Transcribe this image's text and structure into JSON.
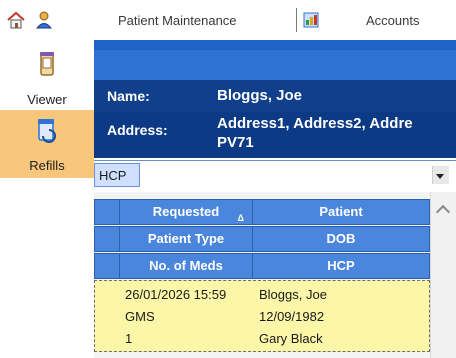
{
  "toolbar": {
    "home_icon": "home-icon",
    "user_icon": "user-icon",
    "patient_maintenance_label": "Patient Maintenance",
    "accounts_icon": "accounts-icon",
    "accounts_label": "Accounts"
  },
  "nav": {
    "items": [
      {
        "label": "Viewer",
        "icon": "viewer-icon",
        "selected": false
      },
      {
        "label": "Refills",
        "icon": "refills-icon",
        "selected": true
      }
    ]
  },
  "patient": {
    "name_label": "Name:",
    "name_value": "Bloggs, Joe",
    "address_label": "Address:",
    "address_line1": "Address1, Address2, Addre",
    "address_line2": "PV71"
  },
  "filter": {
    "selected": "HCP"
  },
  "grid": {
    "header_rows": [
      [
        "Requested",
        "Patient"
      ],
      [
        "Patient Type",
        "DOB"
      ],
      [
        "No. of Meds",
        "HCP"
      ]
    ],
    "sort_indicator": "Δ",
    "record": [
      [
        "26/01/2026 15:59",
        "Bloggs, Joe"
      ],
      [
        "GMS",
        "12/09/1982"
      ],
      [
        "1",
        "Gary Black"
      ]
    ]
  },
  "colors": {
    "header_dark": "#0d3a85",
    "grid_header": "#4a86dc",
    "nav_selected": "#f9c77b",
    "record_highlight": "#fbf6a8"
  }
}
